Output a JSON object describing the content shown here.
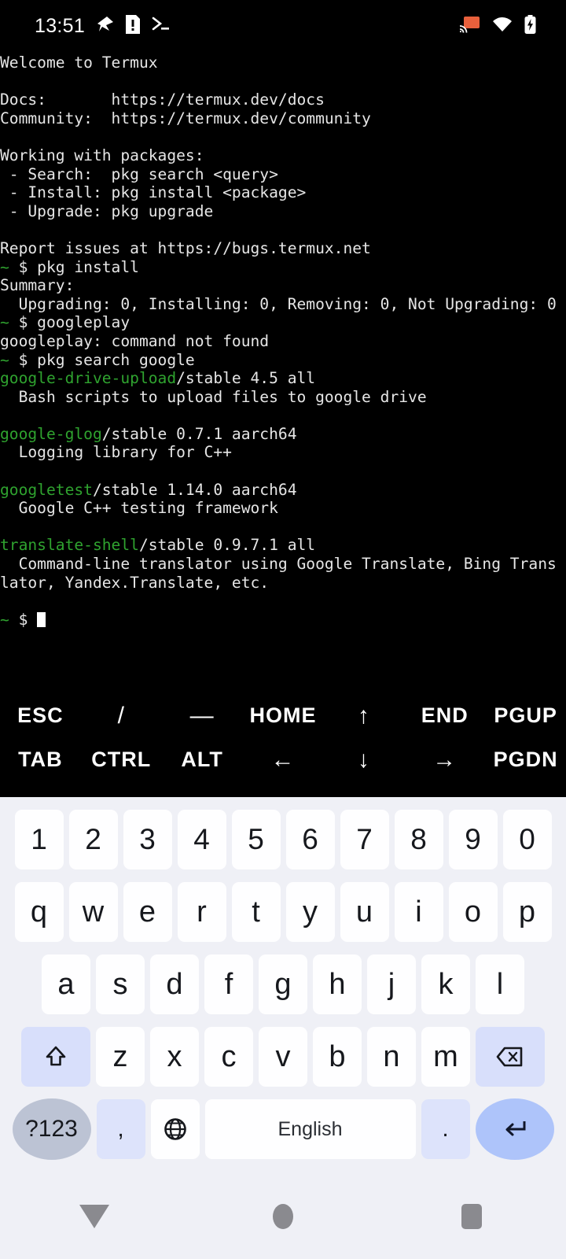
{
  "status_bar": {
    "time": "13:51",
    "left_icons": [
      "notification-icon",
      "sim-card-alert-icon",
      "terminal-icon"
    ],
    "right_icons": [
      "cast-icon",
      "wifi-icon",
      "battery-charging-icon"
    ],
    "cast_color": "#e8603c"
  },
  "terminal": {
    "app": "Termux",
    "prompt_symbol": "~ $",
    "colors": {
      "fg": "#e6e6e6",
      "green": "#2fa32f",
      "bg": "#000000"
    },
    "lines": [
      [
        {
          "t": "Welcome to Termux",
          "c": "w"
        }
      ],
      [
        {
          "t": "",
          "c": "w"
        }
      ],
      [
        {
          "t": "Docs:       https://termux.dev/docs",
          "c": "w"
        }
      ],
      [
        {
          "t": "Community:  https://termux.dev/community",
          "c": "w"
        }
      ],
      [
        {
          "t": "",
          "c": "w"
        }
      ],
      [
        {
          "t": "Working with packages:",
          "c": "w"
        }
      ],
      [
        {
          "t": " - Search:  pkg search <query>",
          "c": "w"
        }
      ],
      [
        {
          "t": " - Install: pkg install <package>",
          "c": "w"
        }
      ],
      [
        {
          "t": " - Upgrade: pkg upgrade",
          "c": "w"
        }
      ],
      [
        {
          "t": "",
          "c": "w"
        }
      ],
      [
        {
          "t": "Report issues at https://bugs.termux.net",
          "c": "w"
        }
      ],
      [
        {
          "t": "~",
          "c": "g"
        },
        {
          "t": " $ pkg install",
          "c": "w"
        }
      ],
      [
        {
          "t": "Summary:",
          "c": "w"
        }
      ],
      [
        {
          "t": "  Upgrading: 0, Installing: 0, Removing: 0, Not Upgrading: 0",
          "c": "w"
        }
      ],
      [
        {
          "t": "~",
          "c": "g"
        },
        {
          "t": " $ googleplay",
          "c": "w"
        }
      ],
      [
        {
          "t": "googleplay: command not found",
          "c": "w"
        }
      ],
      [
        {
          "t": "~",
          "c": "g"
        },
        {
          "t": " $ pkg search google",
          "c": "w"
        }
      ],
      [
        {
          "t": "google-drive-upload",
          "c": "g"
        },
        {
          "t": "/stable 4.5 all",
          "c": "w"
        }
      ],
      [
        {
          "t": "  Bash scripts to upload files to google drive",
          "c": "w"
        }
      ],
      [
        {
          "t": "",
          "c": "w"
        }
      ],
      [
        {
          "t": "google-glog",
          "c": "g"
        },
        {
          "t": "/stable 0.7.1 aarch64",
          "c": "w"
        }
      ],
      [
        {
          "t": "  Logging library for C++",
          "c": "w"
        }
      ],
      [
        {
          "t": "",
          "c": "w"
        }
      ],
      [
        {
          "t": "googletest",
          "c": "g"
        },
        {
          "t": "/stable 1.14.0 aarch64",
          "c": "w"
        }
      ],
      [
        {
          "t": "  Google C++ testing framework",
          "c": "w"
        }
      ],
      [
        {
          "t": "",
          "c": "w"
        }
      ],
      [
        {
          "t": "translate-shell",
          "c": "g"
        },
        {
          "t": "/stable 0.9.7.1 all",
          "c": "w"
        }
      ],
      [
        {
          "t": "  Command-line translator using Google Translate, Bing Trans",
          "c": "w"
        }
      ],
      [
        {
          "t": "lator, Yandex.Translate, etc.",
          "c": "w"
        }
      ],
      [
        {
          "t": "",
          "c": "w"
        }
      ],
      [
        {
          "t": "~",
          "c": "g"
        },
        {
          "t": " $ ",
          "c": "w"
        },
        {
          "t": "",
          "c": "cursor"
        }
      ]
    ]
  },
  "extra_keys": {
    "row1": [
      "ESC",
      "/",
      "—",
      "HOME",
      "↑",
      "END",
      "PGUP"
    ],
    "row2": [
      "TAB",
      "CTRL",
      "ALT",
      "←",
      "↓",
      "→",
      "PGDN"
    ]
  },
  "keyboard": {
    "language_label": "English",
    "numbers": [
      "1",
      "2",
      "3",
      "4",
      "5",
      "6",
      "7",
      "8",
      "9",
      "0"
    ],
    "row_q": [
      "q",
      "w",
      "e",
      "r",
      "t",
      "y",
      "u",
      "i",
      "o",
      "p"
    ],
    "row_a": [
      "a",
      "s",
      "d",
      "f",
      "g",
      "h",
      "j",
      "k",
      "l"
    ],
    "row_z": [
      "z",
      "x",
      "c",
      "v",
      "b",
      "n",
      "m"
    ],
    "shift_label": "⇧",
    "backspace_label": "⌫",
    "symbols_label": "?123",
    "comma_label": ",",
    "globe_label": "⊕",
    "period_label": ".",
    "enter_label": "↵",
    "colors": {
      "bg": "#eff0f6",
      "key": "#fefeff",
      "mod": "#d8dffb",
      "enter": "#aec4fa",
      "symbols": "#bcc3d4"
    }
  },
  "navigation_bar": {
    "back_label": "back",
    "home_label": "home",
    "recents_label": "recents"
  }
}
